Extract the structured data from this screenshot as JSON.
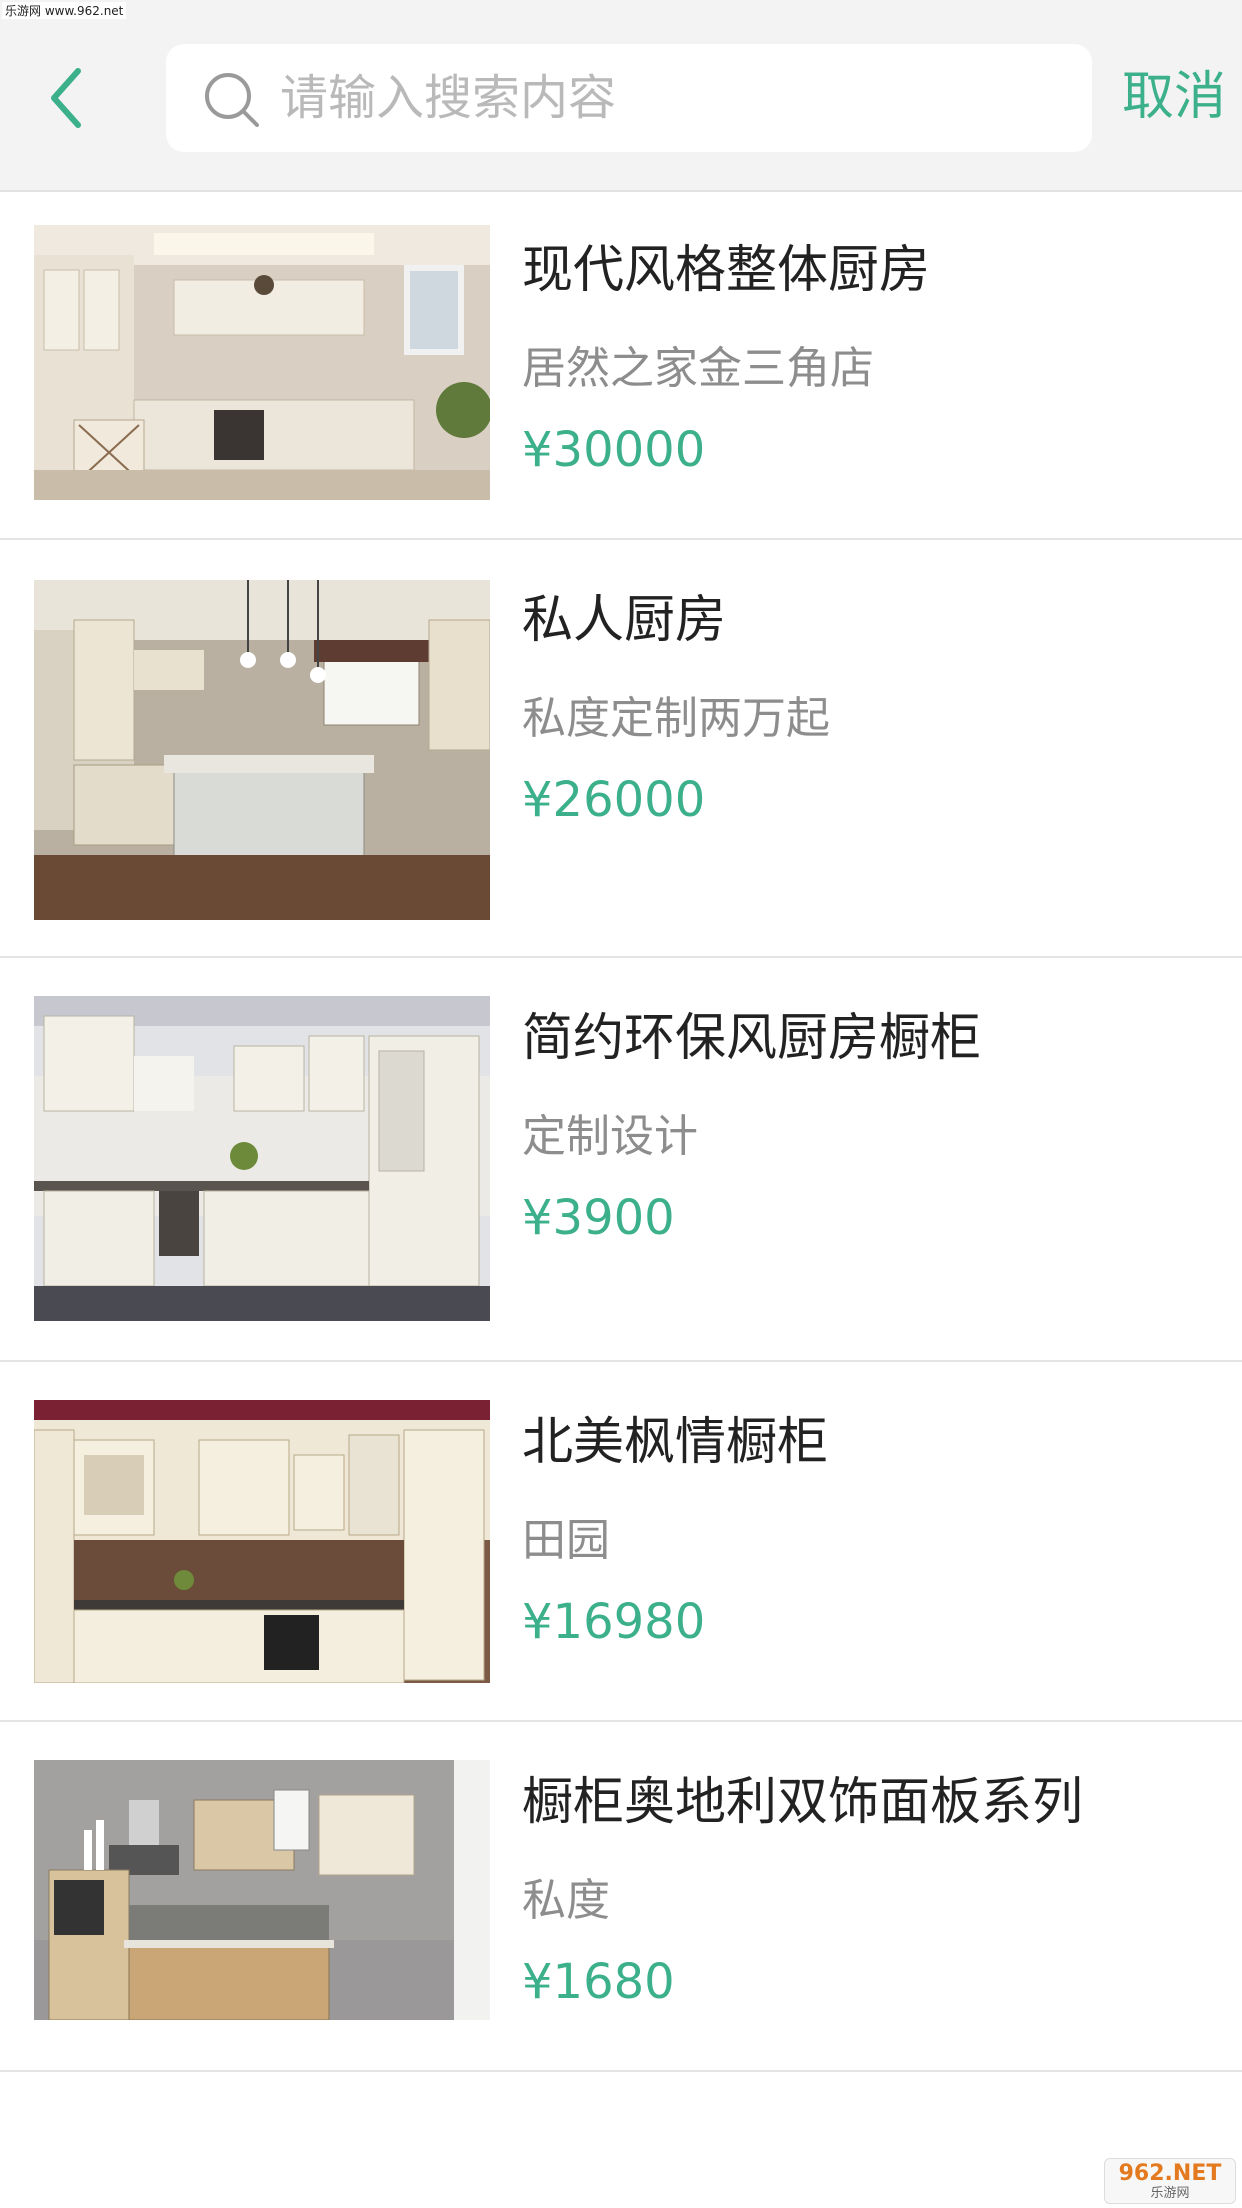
{
  "watermark": {
    "top": "乐游网 www.962.net",
    "bottom_logo": "962.NET",
    "bottom_sub": "乐游网"
  },
  "header": {
    "search_placeholder": "请输入搜索内容",
    "search_value": "",
    "cancel_label": "取消"
  },
  "items": [
    {
      "title": "现代风格整体厨房",
      "subtitle": "居然之家金三角店",
      "price": "¥30000"
    },
    {
      "title": "私人厨房",
      "subtitle": "私度定制两万起",
      "price": "¥26000"
    },
    {
      "title": "简约环保风厨房橱柜",
      "subtitle": "定制设计",
      "price": "¥3900"
    },
    {
      "title": "北美枫情橱柜",
      "subtitle": "田园",
      "price": "¥16980"
    },
    {
      "title": "橱柜奥地利双饰面板系列",
      "subtitle": "私度",
      "price": "¥1680"
    }
  ],
  "colors": {
    "accent": "#3bb08b",
    "header_bg": "#f3f3f3",
    "divider": "#e4e4e4"
  }
}
